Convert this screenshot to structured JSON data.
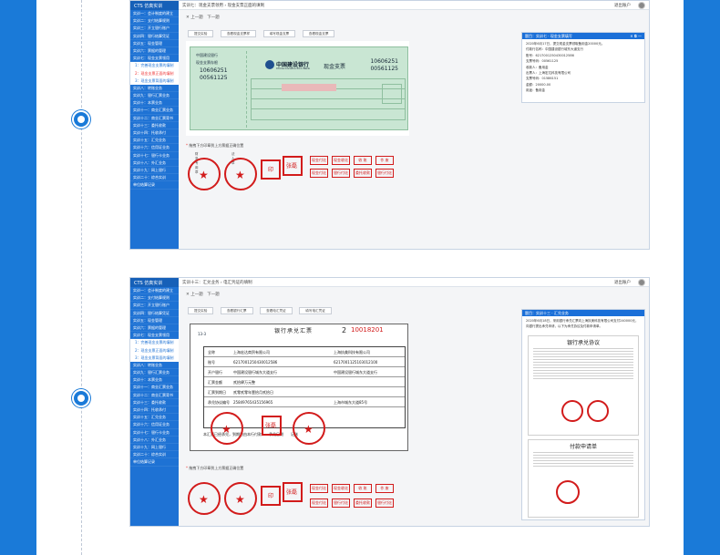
{
  "colors": {
    "page_bg": "#1a7ad8",
    "sidebar": "#1e72d4",
    "seal_red": "#d21b1b",
    "panel_head": "#1a6fd8"
  },
  "app": {
    "logo": "CTS 仿真实训"
  },
  "screen1": {
    "crumb": "实训七：现金支票领用 › 现金支票正面的填制",
    "exit": "退出账户",
    "nav": "✕ 上一题　下一题",
    "sidebar": [
      "实训一：会计制度的建立",
      "实训二：支付结算规则",
      "实训三：开立银行账户",
      "实训四：银行结算凭证",
      "实训五：现金管理",
      "实训六：票据的管理",
      "实训七：现金支票领用",
      "1：完善现金支票的填制",
      "2：现金支票正面的填制",
      "3：现金支票背面的填制",
      "实训八：转账业务",
      "实训九：银行汇票业务",
      "实训十：本票业务",
      "实训十一：商业汇票业务",
      "实训十二：商业汇票背书",
      "实训十三：委托收款",
      "实训十四：托收承付",
      "实训十五：汇兑业务",
      "实训十六：信用证业务",
      "实训十七：银行卡业务",
      "实训十八：外汇业务",
      "实训十九：网上银行",
      "实训二十：综合实训",
      "单位结算记录"
    ],
    "tabs": [
      "提交实验",
      "查看现金支票样",
      "填写现金支票",
      "查看现金支票"
    ],
    "cheque": {
      "stub_bank": "中国建设银行",
      "stub_type": "现金支票存根",
      "stub_code_1": "10606251",
      "stub_code_2": "00561125",
      "bank_name": "中国建设银行",
      "bank_en": "China Construction Bank",
      "type": "现金支票",
      "code_1": "10606251",
      "code_2": "00561125"
    },
    "hint": "拖拽下方印章到上方票据正确位置",
    "panel": {
      "title": "题目：实训七 · 现金支票填写",
      "btns": "✕ ⧉ —",
      "lines": [
        "2020年6月17日，提交现金支票领取备用金20000元。",
        "付款行名称：中国建设银行城东大道支行",
        "账号：6217001250430012586",
        "支票号码：00561125",
        "收款人：备用金",
        "出票人：上海宏达科技有限公司",
        "支票号码：01586151",
        "金额：20000.00",
        "用途：备用金"
      ]
    },
    "seals": {
      "round_caps": [
        "财务专用章",
        "法人章"
      ],
      "square_1": "印",
      "square_2": "张磊",
      "labels_row1": [
        "现金付讫",
        "现金收讫",
        "收 账",
        "作 废"
      ],
      "labels_row2": [
        "现金付讫",
        "银行付讫",
        "委托收款",
        "银行付讫"
      ]
    }
  },
  "screen2": {
    "crumb": "实训十三：汇兑业务 › 电汇凭证的填制",
    "exit": "退出账户",
    "nav": "✕ 上一题　下一题",
    "tabs": [
      "提交实验",
      "查看银行汇票",
      "查看电汇凭证",
      "填写电汇凭证"
    ],
    "remit": {
      "title": "银行承兑汇票",
      "page_no": "2",
      "number": "10018201",
      "left_label": "13-3",
      "rows": [
        {
          "label": "全称",
          "left": "上海宏达商贸有限公司",
          "right": "上海执美科技有限公司"
        },
        {
          "label": "账号",
          "left": "6217001250430012586",
          "right": "6217001125103012100"
        },
        {
          "label": "开户银行",
          "left": "中国建设银行城东大道支行",
          "right": "中国建设银行城东大道支行"
        },
        {
          "label": "汇票金额",
          "left": "贰拾肆万元整",
          "right": ""
        },
        {
          "label": "汇票到期日",
          "left": "贰零贰零年壹拾月贰拾日",
          "right": ""
        },
        {
          "label": "承兑协议编号",
          "left": "25849765435156965",
          "right": "上海市城东大道85号"
        }
      ],
      "foot": "本汇票已经承兑，到期日由本行付款　　承兑日期　　记账"
    },
    "hint": "拖拽下方印章到上方票据正确位置",
    "panel": {
      "title": "题目：实训十三 · 汇兑业务",
      "lines": [
        "2020年6月18日，采用银行承兑汇票向上海执美科技有限公司支付240000元，",
        "向银行提出承兑申请，以下为承兑协议及付款申请单。"
      ],
      "doc1_title": "银行承兑协议",
      "doc2_title": "付款申请单"
    },
    "seals": {
      "square_1": "印",
      "square_2": "张磊",
      "labels_row1": [
        "现金付讫",
        "现金收讫",
        "收 账",
        "作 废"
      ],
      "labels_row2": [
        "现金付讫",
        "银行付讫",
        "委托收款",
        "银行付讫"
      ]
    }
  }
}
